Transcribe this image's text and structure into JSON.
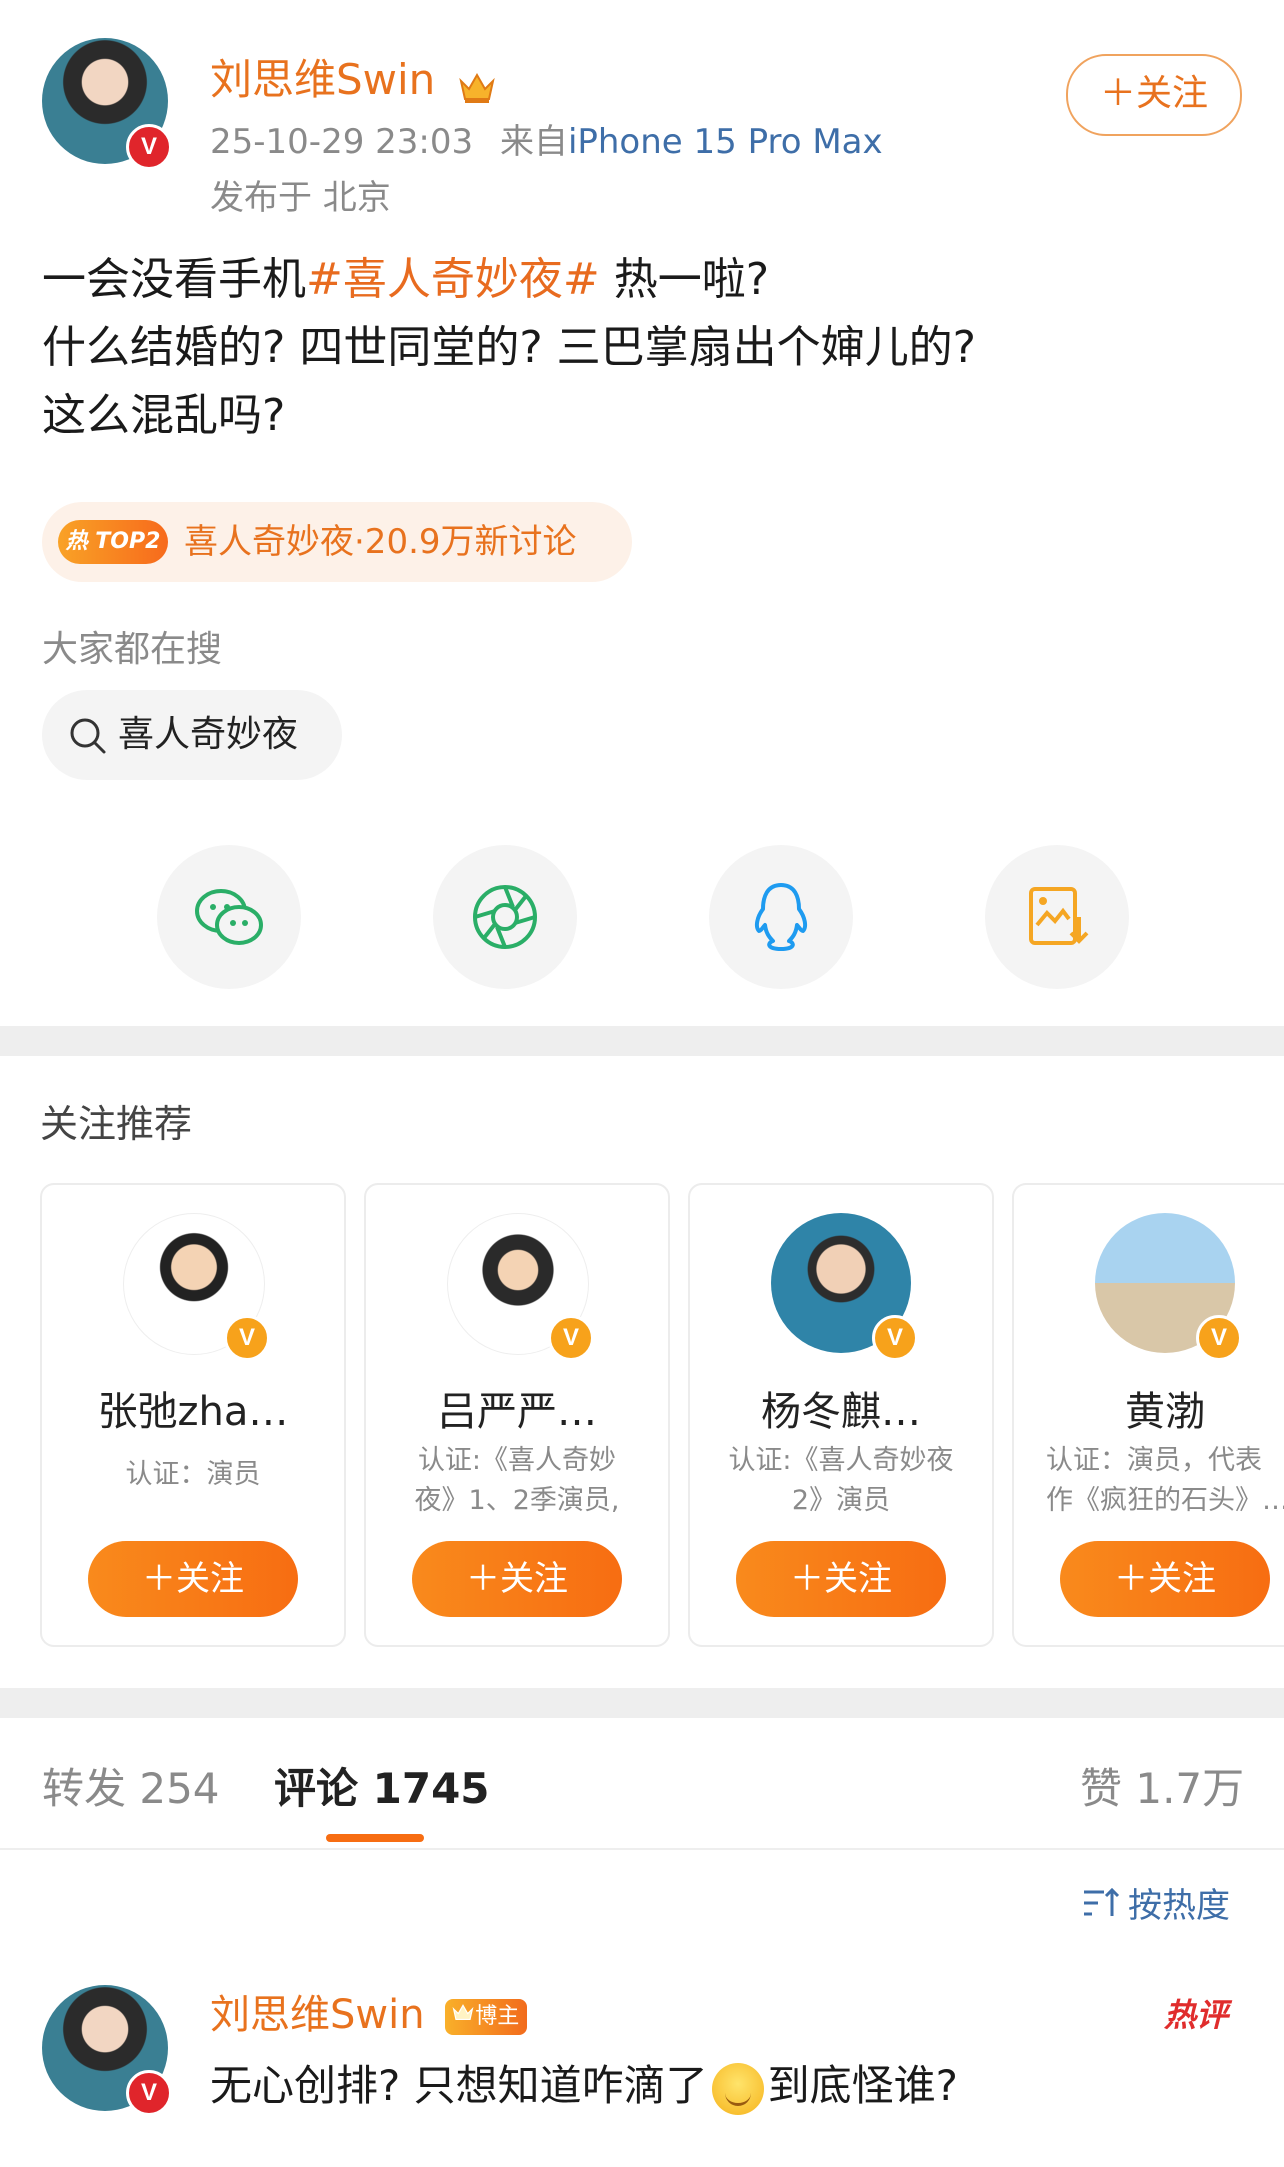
{
  "post": {
    "author": "刘思维Swin",
    "crown_icon": "crown-icon",
    "timestamp": "25-10-29 23:03",
    "source_prefix": "来自",
    "source_device": "iPhone 15 Pro Max",
    "location": "发布于 北京",
    "follow_label": "＋关注",
    "text_line1_pre": "一会没看手机",
    "text_line1_tag": "#喜人奇妙夜#",
    "text_line1_post": " 热一啦?",
    "text_line2": "什么结婚的? 四世同堂的? 三巴掌扇出个婶儿的?",
    "text_line3": "这么混乱吗?",
    "hot": {
      "badge_hot": "热",
      "badge_rank": "TOP2",
      "text": "喜人奇妙夜·20.9万新讨论"
    },
    "search_label": "大家都在搜",
    "search_term": "喜人奇妙夜",
    "share_icons": [
      "wechat-icon",
      "moments-icon",
      "qq-icon",
      "save-image-icon"
    ]
  },
  "recommend": {
    "title": "关注推荐",
    "cards": [
      {
        "name": "张弛zha…",
        "desc1": "认证：演员",
        "desc2": "",
        "follow": "＋关注"
      },
      {
        "name": "吕严严…",
        "desc1": "认证:《喜人奇妙",
        "desc2": "夜》1、2季演员,",
        "follow": "＋关注"
      },
      {
        "name": "杨冬麒…",
        "desc1": "认证:《喜人奇妙夜",
        "desc2": "2》演员",
        "follow": "＋关注"
      },
      {
        "name": "黄渤",
        "desc1": "认证：演员，代表",
        "desc2": "作《疯狂的石头》…",
        "follow": "＋关注"
      }
    ]
  },
  "tabs": {
    "repost": "转发 254",
    "comment": "评论 1745",
    "like": "赞 1.7万"
  },
  "sort_label": "按热度",
  "comment": {
    "author": "刘思维Swin",
    "badge": "博主",
    "hot_label": "热评",
    "text_pre": "无心创排? 只想知道咋滴了",
    "text_post": "到底怪谁?"
  },
  "colors": {
    "accent": "#e86b1f",
    "verified": "#f7a21b",
    "link_blue": "#3e6ea8"
  }
}
